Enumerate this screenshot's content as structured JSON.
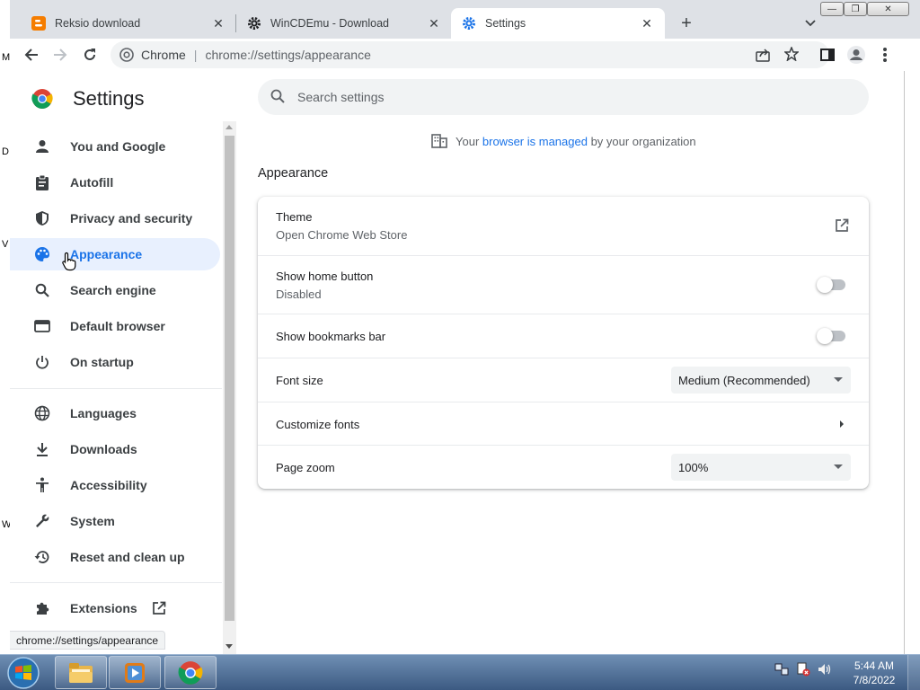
{
  "tabs": [
    {
      "title": "Reksio download",
      "favicon": "blogger-icon",
      "active": false
    },
    {
      "title": "WinCDEmu - Download",
      "favicon": "gear-icon",
      "active": false
    },
    {
      "title": "Settings",
      "favicon": "settings-gear-icon",
      "active": true
    }
  ],
  "tabstrip": {
    "new_tab": "+",
    "close_glyph": "✕"
  },
  "window_controls": {
    "minimize": "—",
    "maximize": "❐",
    "close": "✕"
  },
  "omnibox": {
    "site": "Chrome",
    "divider": "|",
    "url": "chrome://settings/appearance"
  },
  "side_strip_letters": [
    "M",
    "D",
    "V",
    "W"
  ],
  "sidebar": {
    "title": "Settings",
    "items": [
      {
        "label": "You and Google",
        "icon": "person-icon"
      },
      {
        "label": "Autofill",
        "icon": "clipboard-icon"
      },
      {
        "label": "Privacy and security",
        "icon": "shield-icon"
      },
      {
        "label": "Appearance",
        "icon": "palette-icon",
        "selected": true
      },
      {
        "label": "Search engine",
        "icon": "search-icon"
      },
      {
        "label": "Default browser",
        "icon": "browser-window-icon"
      },
      {
        "label": "On startup",
        "icon": "power-icon"
      },
      {
        "label": "Languages",
        "icon": "globe-icon"
      },
      {
        "label": "Downloads",
        "icon": "download-icon"
      },
      {
        "label": "Accessibility",
        "icon": "accessibility-icon"
      },
      {
        "label": "System",
        "icon": "wrench-icon"
      },
      {
        "label": "Reset and clean up",
        "icon": "restore-icon"
      },
      {
        "label": "Extensions",
        "icon": "puzzle-icon"
      }
    ]
  },
  "status_bubble": "chrome://settings/appearance",
  "main": {
    "search_placeholder": "Search settings",
    "managed_notice": {
      "pre": "Your ",
      "link": "browser is managed",
      "post": " by your organization"
    },
    "section_title": "Appearance",
    "rows": [
      {
        "label": "Theme",
        "sub": "Open Chrome Web Store",
        "control": "external-link"
      },
      {
        "label": "Show home button",
        "sub": "Disabled",
        "control": "toggle",
        "on": false
      },
      {
        "label": "Show bookmarks bar",
        "control": "toggle",
        "on": false
      },
      {
        "label": "Font size",
        "control": "select",
        "value": "Medium (Recommended)"
      },
      {
        "label": "Customize fonts",
        "control": "chevron"
      },
      {
        "label": "Page zoom",
        "control": "select",
        "value": "100%"
      }
    ]
  },
  "taskbar": {
    "apps": [
      "explorer-folder-icon",
      "media-player-icon",
      "chrome-icon"
    ],
    "time": "5:44 AM",
    "date": "7/8/2022"
  },
  "colors": {
    "accent": "#1a73e8",
    "selected_bg": "#e8f0fe",
    "taskbar": "#3c5a82"
  }
}
